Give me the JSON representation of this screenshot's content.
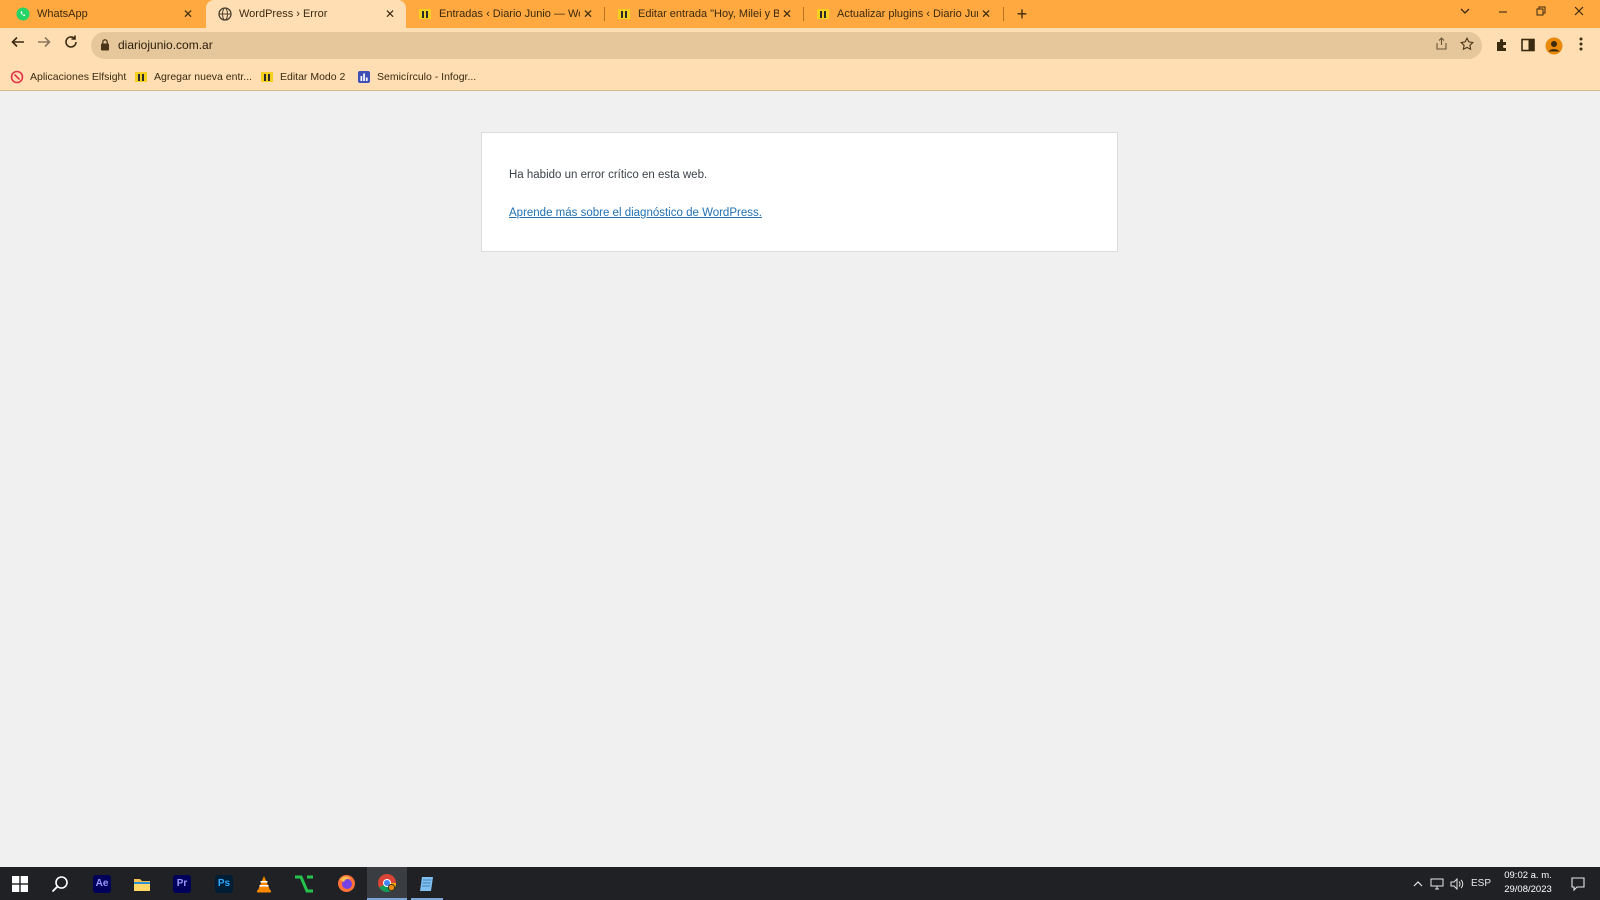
{
  "browser": {
    "tabs": [
      {
        "title": "WhatsApp",
        "icon": "whatsapp-icon",
        "active": false
      },
      {
        "title": "WordPress › Error",
        "icon": "wordpress-globe-icon",
        "active": true
      },
      {
        "title": "Entradas ‹ Diario Junio — WordP",
        "icon": "diario-junio-icon",
        "active": false
      },
      {
        "title": "Editar entrada \"Hoy, Milei y Bullr",
        "icon": "diario-junio-icon",
        "active": false
      },
      {
        "title": "Actualizar plugins ‹ Diario Junio —",
        "icon": "diario-junio-icon",
        "active": false
      }
    ],
    "new_tab_symbol": "+",
    "url": "diariojunio.com.ar",
    "bookmarks": [
      {
        "label": "Aplicaciones Elfsight",
        "icon": "elfsight-icon"
      },
      {
        "label": "Agregar nueva entr...",
        "icon": "diario-junio-icon"
      },
      {
        "label": "Editar Modo 2",
        "icon": "diario-junio-icon"
      },
      {
        "label": "Semicírculo - Infogr...",
        "icon": "infogram-icon"
      }
    ],
    "colors": {
      "frame": "#ffa940",
      "toolbar": "#ffdeb3",
      "omnibox": "#e6c79c"
    }
  },
  "page": {
    "error_message": "Ha habido un error crítico en esta web.",
    "help_link": "Aprende más sobre el diagnóstico de WordPress.",
    "colors": {
      "background": "#f0f0f1",
      "link": "#2271b1",
      "text": "#3c434a"
    }
  },
  "taskbar": {
    "apps": [
      {
        "name": "start",
        "icon": "windows-start-icon"
      },
      {
        "name": "search",
        "icon": "search-icon"
      },
      {
        "name": "Ae",
        "icon": "after-effects-icon"
      },
      {
        "name": "files",
        "icon": "file-explorer-icon"
      },
      {
        "name": "Pr",
        "icon": "premiere-icon"
      },
      {
        "name": "Ps",
        "icon": "photoshop-icon"
      },
      {
        "name": "vlc",
        "icon": "vlc-icon"
      },
      {
        "name": "app",
        "icon": "green-app-icon"
      },
      {
        "name": "firefox",
        "icon": "firefox-icon"
      },
      {
        "name": "chrome",
        "icon": "chrome-icon"
      },
      {
        "name": "notepad",
        "icon": "notepad-icon"
      }
    ],
    "tray": {
      "language": "ESP",
      "time": "09:02 a. m.",
      "date": "29/08/2023"
    }
  }
}
